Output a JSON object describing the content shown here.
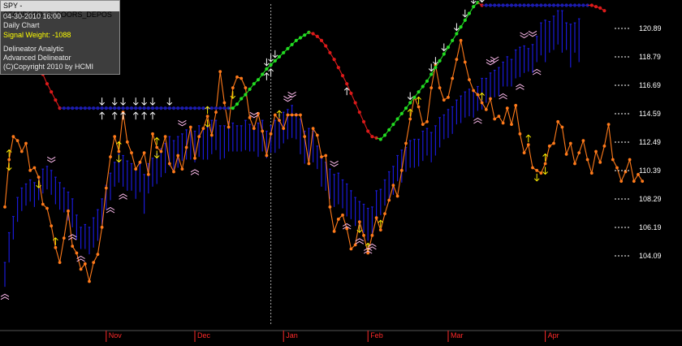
{
  "info": {
    "symbol_line": "SPY - STANDARD_&_POORS_DEPOS",
    "datetime": "04-30-2010  16:00",
    "period": "Daily Chart",
    "signal_weight": "Signal Weight: -1088",
    "line1": "Delineator Analytic",
    "line2": "Advanced Delineator",
    "copyright": "(C)Copyright 2010 by HCMI"
  },
  "colors": {
    "background": "#000000",
    "price_bars": "#1a1ad6",
    "oscillator": "#ff7a1a",
    "delineator_up": "#22dd22",
    "delineator_down": "#dd1a1a",
    "delineator_flat": "#1c1cb0",
    "arrows_white": "#ffffff",
    "arrows_yellow": "#ffee00",
    "chevrons": "#ffbbee",
    "month_labels": "#ff2a2a",
    "cursor_line": "#aaaaaa"
  },
  "chart_data": {
    "type": "line",
    "y_ticks": [
      "120.89",
      "118.79",
      "116.69",
      "114.59",
      "112.49",
      "110.39",
      "108.29",
      "106.19",
      "104.09"
    ],
    "ylim": [
      101.6,
      124.0
    ],
    "x_months": [
      "Nov",
      "Dec",
      "Jan",
      "Feb",
      "Mar",
      "Apr"
    ],
    "month_start_index": [
      24,
      45,
      66,
      86,
      105,
      128
    ],
    "cursor_index": 63,
    "price_bars": [
      [
        103.6,
        101.8
      ],
      [
        105.8,
        103.6
      ],
      [
        107.0,
        105.3
      ],
      [
        108.4,
        106.6
      ],
      [
        109.1,
        107.4
      ],
      [
        109.4,
        107.8
      ],
      [
        109.7,
        108.1
      ],
      [
        109.5,
        107.7
      ],
      [
        109.9,
        108.2
      ],
      [
        110.5,
        108.7
      ],
      [
        110.7,
        109.0
      ],
      [
        110.4,
        108.6
      ],
      [
        109.9,
        107.9
      ],
      [
        109.5,
        107.5
      ],
      [
        109.1,
        107.3
      ],
      [
        108.8,
        106.7
      ],
      [
        108.3,
        106.2
      ],
      [
        107.1,
        105.3
      ],
      [
        106.2,
        104.6
      ],
      [
        106.4,
        104.6
      ],
      [
        106.2,
        104.2
      ],
      [
        106.9,
        104.7
      ],
      [
        107.5,
        105.2
      ],
      [
        108.3,
        106.4
      ],
      [
        109.3,
        107.5
      ],
      [
        110.2,
        108.2
      ],
      [
        111.0,
        109.2
      ],
      [
        111.6,
        109.5
      ],
      [
        111.5,
        109.2
      ],
      [
        111.1,
        108.9
      ],
      [
        110.9,
        108.9
      ],
      [
        110.5,
        108.3
      ],
      [
        110.9,
        108.8
      ],
      [
        110.1,
        107.2
      ],
      [
        110.9,
        108.7
      ],
      [
        111.3,
        109.2
      ],
      [
        111.6,
        109.4
      ],
      [
        112.0,
        109.9
      ],
      [
        112.4,
        110.2
      ],
      [
        112.9,
        110.7
      ],
      [
        112.6,
        110.4
      ],
      [
        112.9,
        110.6
      ],
      [
        113.1,
        111.1
      ],
      [
        113.4,
        111.2
      ],
      [
        113.5,
        111.2
      ],
      [
        113.3,
        111.0
      ],
      [
        113.7,
        111.4
      ],
      [
        113.5,
        111.2
      ],
      [
        113.6,
        111.2
      ],
      [
        114.1,
        111.6
      ],
      [
        114.1,
        111.9
      ],
      [
        113.7,
        111.2
      ],
      [
        113.7,
        111.3
      ],
      [
        114.0,
        111.8
      ],
      [
        113.9,
        111.8
      ],
      [
        113.7,
        111.8
      ],
      [
        113.7,
        111.8
      ],
      [
        114.1,
        111.9
      ],
      [
        113.8,
        111.8
      ],
      [
        113.7,
        111.8
      ],
      [
        113.9,
        111.4
      ],
      [
        114.1,
        111.8
      ],
      [
        113.3,
        111.3
      ],
      [
        113.7,
        111.7
      ],
      [
        114.1,
        111.7
      ],
      [
        114.5,
        112.0
      ],
      [
        114.7,
        112.4
      ],
      [
        114.9,
        112.7
      ],
      [
        115.2,
        112.8
      ],
      [
        114.6,
        112.7
      ],
      [
        114.2,
        111.6
      ],
      [
        113.3,
        110.9
      ],
      [
        113.5,
        111.2
      ],
      [
        113.3,
        111.0
      ],
      [
        112.2,
        110.5
      ],
      [
        111.3,
        109.2
      ],
      [
        111.0,
        108.9
      ],
      [
        110.5,
        108.3
      ],
      [
        110.1,
        107.7
      ],
      [
        110.2,
        107.9
      ],
      [
        109.7,
        107.6
      ],
      [
        109.4,
        107.0
      ],
      [
        108.9,
        106.8
      ],
      [
        108.4,
        106.3
      ],
      [
        108.1,
        105.9
      ],
      [
        107.9,
        105.8
      ],
      [
        107.6,
        105.2
      ],
      [
        107.7,
        105.5
      ],
      [
        108.9,
        106.7
      ],
      [
        109.0,
        107.1
      ],
      [
        109.7,
        107.8
      ],
      [
        110.3,
        108.3
      ],
      [
        110.7,
        108.6
      ],
      [
        111.5,
        109.6
      ],
      [
        111.9,
        109.5
      ],
      [
        112.1,
        110.3
      ],
      [
        112.6,
        110.6
      ],
      [
        112.7,
        110.6
      ],
      [
        112.7,
        110.7
      ],
      [
        113.3,
        111.1
      ],
      [
        113.5,
        111.5
      ],
      [
        113.2,
        111.0
      ],
      [
        113.7,
        111.5
      ],
      [
        114.3,
        112.1
      ],
      [
        114.5,
        112.7
      ],
      [
        114.9,
        112.8
      ],
      [
        115.1,
        113.1
      ],
      [
        115.6,
        113.8
      ],
      [
        115.9,
        113.9
      ],
      [
        116.2,
        114.3
      ],
      [
        116.4,
        114.4
      ],
      [
        116.3,
        114.3
      ],
      [
        116.6,
        114.8
      ],
      [
        117.2,
        114.9
      ],
      [
        117.2,
        115.4
      ],
      [
        117.6,
        115.8
      ],
      [
        117.8,
        115.8
      ],
      [
        118.0,
        115.9
      ],
      [
        118.4,
        116.6
      ],
      [
        118.8,
        116.6
      ],
      [
        118.6,
        116.6
      ],
      [
        119.3,
        117.2
      ],
      [
        119.5,
        117.3
      ],
      [
        119.6,
        117.6
      ],
      [
        119.4,
        117.7
      ],
      [
        119.7,
        117.6
      ],
      [
        120.3,
        118.4
      ],
      [
        121.3,
        118.9
      ],
      [
        121.5,
        118.4
      ],
      [
        121.4,
        119.1
      ],
      [
        121.8,
        119.3
      ],
      [
        122.2,
        119.7
      ],
      [
        122.2,
        119.1
      ],
      [
        121.3,
        119.3
      ],
      [
        121.2,
        118.0
      ],
      [
        121.3,
        119.1
      ],
      [
        121.6,
        118.4
      ]
    ],
    "delineator": [
      124.0,
      123.2,
      122.5,
      121.8,
      121.0,
      120.3,
      119.6,
      118.9,
      118.2,
      117.5,
      116.8,
      116.2,
      115.6,
      115.0,
      115.0,
      115.0,
      115.0,
      115.0,
      115.0,
      115.0,
      115.0,
      115.0,
      115.0,
      115.0,
      115.0,
      115.0,
      115.0,
      115.0,
      115.0,
      115.0,
      115.0,
      115.0,
      115.0,
      115.0,
      115.0,
      115.0,
      115.0,
      115.0,
      115.0,
      115.0,
      115.0,
      115.0,
      115.0,
      115.0,
      115.0,
      115.0,
      115.0,
      115.0,
      115.0,
      115.0,
      115.0,
      115.0,
      115.0,
      115.0,
      115.0,
      115.3,
      115.7,
      116.0,
      116.4,
      116.8,
      117.1,
      117.5,
      117.9,
      118.2,
      118.5,
      118.8,
      119.1,
      119.4,
      119.7,
      120.0,
      120.2,
      120.4,
      120.6,
      120.5,
      120.3,
      120.0,
      119.6,
      119.1,
      118.6,
      118.0,
      117.4,
      116.8,
      116.1,
      115.4,
      114.7,
      114.0,
      113.3,
      112.9,
      112.8,
      112.7,
      113.0,
      113.4,
      113.8,
      114.2,
      114.6,
      115.0,
      115.4,
      115.8,
      116.2,
      116.6,
      117.0,
      117.5,
      118.0,
      118.5,
      119.0,
      119.5,
      120.0,
      120.5,
      121.0,
      121.5,
      122.0,
      122.5,
      122.8,
      122.6,
      122.6,
      122.6,
      122.6,
      122.6,
      122.6,
      122.6,
      122.6,
      122.6,
      122.6,
      122.6,
      122.6,
      122.6,
      122.6,
      122.6,
      122.6,
      122.6,
      122.6,
      122.6,
      122.6,
      122.6,
      122.6,
      122.6,
      122.6,
      122.6,
      122.6,
      122.6,
      122.5,
      122.4,
      122.2
    ],
    "oscillator": [
      107.7,
      111.2,
      112.9,
      112.6,
      111.8,
      112.4,
      110.4,
      110.6,
      109.9,
      107.9,
      107.6,
      106.3,
      104.7,
      103.6,
      105.4,
      107.4,
      104.8,
      104.3,
      103.1,
      103.5,
      102.2,
      103.6,
      104.2,
      106.2,
      109.1,
      111.4,
      112.9,
      111.8,
      114.7,
      112.5,
      111.7,
      110.5,
      111.0,
      111.7,
      110.1,
      113.1,
      112.1,
      111.8,
      112.9,
      110.9,
      110.3,
      111.5,
      110.5,
      112.1,
      113.6,
      111.3,
      112.9,
      113.5,
      114.4,
      113.0,
      114.7,
      117.7,
      115.4,
      113.6,
      116.5,
      117.3,
      117.2,
      116.5,
      114.3,
      113.5,
      114.6,
      113.3,
      111.5,
      113.1,
      114.5,
      114.1,
      113.5,
      114.5,
      114.5,
      114.5,
      114.5,
      112.9,
      110.9,
      113.5,
      113.0,
      111.4,
      111.5,
      107.7,
      105.9,
      106.8,
      107.1,
      106.1,
      104.6,
      104.9,
      106.6,
      105.6,
      104.3,
      105.6,
      106.9,
      106.0,
      107.2,
      108.2,
      109.3,
      108.5,
      110.4,
      112.4,
      114.2,
      115.8,
      115.1,
      113.8,
      114.0,
      116.5,
      118.2,
      116.5,
      115.6,
      115.8,
      117.2,
      118.6,
      120.0,
      118.4,
      117.1,
      116.3,
      116.0,
      115.4,
      114.9,
      115.7,
      114.2,
      114.4,
      113.9,
      115.0,
      113.8,
      115.2,
      113.1,
      111.7,
      112.3,
      110.6,
      110.4,
      110.2,
      110.9,
      112.2,
      112.4,
      114.0,
      113.6,
      111.6,
      112.4,
      110.9,
      111.7,
      112.6,
      111.2,
      110.2,
      111.8,
      111.0,
      112.2,
      113.8,
      111.2,
      110.6,
      109.6,
      110.3,
      111.2,
      109.6,
      110.1,
      109.6
    ],
    "white_arrows_down": [
      23,
      26,
      28,
      31,
      33,
      35,
      39,
      62,
      63,
      64,
      96,
      101,
      102,
      104,
      107,
      109,
      111,
      113
    ],
    "white_arrows_up": [
      23,
      26,
      28,
      31,
      33,
      35,
      62,
      63,
      81
    ],
    "yellow_arrows_up": [
      1,
      12,
      27,
      36,
      48,
      65,
      86,
      89,
      96,
      98,
      113,
      124,
      128
    ],
    "yellow_arrows_down": [
      1,
      8,
      27,
      36,
      48,
      54,
      84,
      126,
      128
    ],
    "chevrons_down": [
      11,
      42,
      59,
      67,
      68,
      78,
      115,
      116,
      123,
      125
    ],
    "chevrons_up": [
      0,
      16,
      18,
      25,
      28,
      45,
      81,
      84,
      86,
      87,
      112,
      118,
      122,
      126
    ]
  }
}
